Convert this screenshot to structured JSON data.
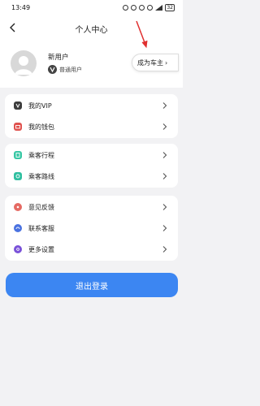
{
  "status_bar": {
    "time": "13:49",
    "battery": "32"
  },
  "header": {
    "title": "个人中心"
  },
  "profile": {
    "username": "新用户",
    "user_type": "普通用户",
    "become_owner_label": "成为车主"
  },
  "menu_groups": [
    {
      "items": [
        {
          "label": "我的VIP",
          "icon": "vip-icon",
          "color": "#3d3d3d"
        },
        {
          "label": "我的钱包",
          "icon": "wallet-icon",
          "color": "#e0524e"
        }
      ]
    },
    {
      "items": [
        {
          "label": "乘客行程",
          "icon": "trip-icon",
          "color": "#37c7a4"
        },
        {
          "label": "乘客路线",
          "icon": "route-icon",
          "color": "#2fbfa0"
        }
      ]
    },
    {
      "items": [
        {
          "label": "意见反馈",
          "icon": "feedback-icon",
          "color": "#e56a63"
        },
        {
          "label": "联系客服",
          "icon": "customer-service-icon",
          "color": "#4a72e0"
        },
        {
          "label": "更多设置",
          "icon": "settings-icon",
          "color": "#7a52d9"
        }
      ]
    }
  ],
  "logout": {
    "label": "退出登录"
  },
  "colors": {
    "accent": "#3c86f2",
    "annotation_arrow": "#e03030"
  }
}
